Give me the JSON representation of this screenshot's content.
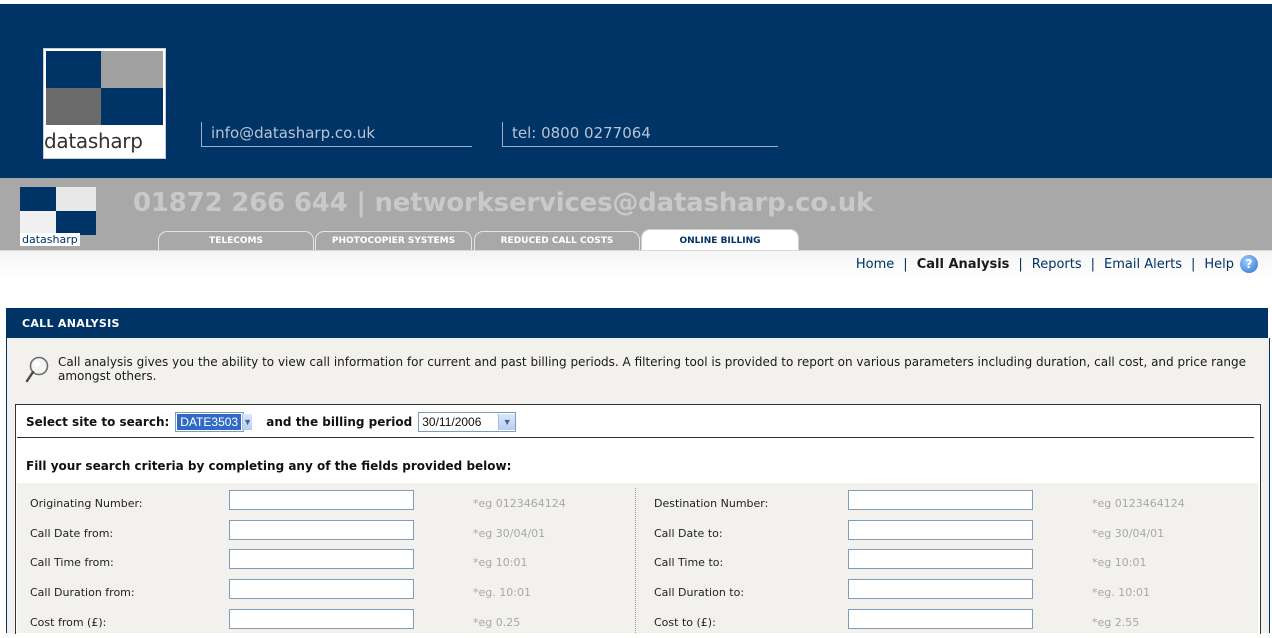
{
  "header": {
    "logo_text": "datasharp",
    "email": "info@datasharp.co.uk",
    "phone": "tel: 0800 0277064"
  },
  "subheader": {
    "logo_text": "datasharp",
    "headline": "01872 266 644 | networkservices@datasharp.co.uk",
    "tabs": [
      {
        "label": "TELECOMS",
        "active": false
      },
      {
        "label": "PHOTOCOPIER SYSTEMS",
        "active": false
      },
      {
        "label": "REDUCED CALL COSTS",
        "active": false
      },
      {
        "label": "ONLINE BILLING",
        "active": true
      }
    ]
  },
  "nav": {
    "items": [
      "Home",
      "Call Analysis",
      "Reports",
      "Email Alerts",
      "Help"
    ],
    "current": "Call Analysis",
    "separator": "|"
  },
  "panel": {
    "title": "CALL ANALYSIS",
    "intro": "Call analysis gives you the ability to view call information for current and past billing periods. A filtering tool is provided to report on various parameters including duration, call cost, and price range amongst others."
  },
  "search": {
    "site_label": "Select site to search:",
    "site_value": "DATE3503",
    "period_label": "and the billing period",
    "period_value": "30/11/2006",
    "criteria_title": "Fill your search criteria by completing any of the fields provided below:"
  },
  "criteria": [
    {
      "left_label": "Originating Number:",
      "left_value": "",
      "left_hint": "*eg 0123464124",
      "right_label": "Destination Number:",
      "right_value": "",
      "right_hint": "*eg 0123464124"
    },
    {
      "left_label": "Call Date from:",
      "left_value": "",
      "left_hint": "*eg 30/04/01",
      "right_label": "Call Date to:",
      "right_value": "",
      "right_hint": "*eg 30/04/01"
    },
    {
      "left_label": "Call Time from:",
      "left_value": "",
      "left_hint": "*eg 10:01",
      "right_label": "Call Time to:",
      "right_value": "",
      "right_hint": "*eg 10:01"
    },
    {
      "left_label": "Call Duration from:",
      "left_value": "",
      "left_hint": "*eg. 10:01",
      "right_label": "Call Duration to:",
      "right_value": "",
      "right_hint": "*eg. 10:01"
    },
    {
      "left_label": "Cost from (£):",
      "left_value": "",
      "left_hint": "*eg 0.25",
      "right_label": "Cost to (£):",
      "right_value": "",
      "right_hint": "*eg 2.55"
    }
  ],
  "colors": {
    "brand_navy": "#003366",
    "band_grey": "#a8a8a8",
    "panel_bg": "#f2f1ee",
    "hint_grey": "#a8a8a8"
  }
}
